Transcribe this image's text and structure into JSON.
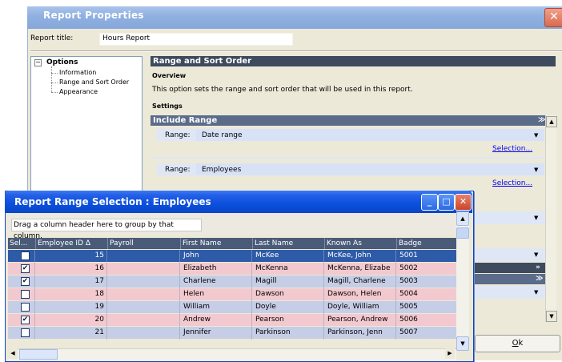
{
  "report_properties": {
    "title": "Report Properties",
    "close_glyph": "✕",
    "report_title_label": "Report title:",
    "report_title_value": "Hours Report",
    "tree": {
      "root": "Options",
      "expander": "−",
      "items": [
        "Information",
        "Range and Sort Order",
        "Appearance"
      ]
    },
    "section_title": "Range and Sort Order",
    "overview_label": "Overview",
    "overview_text": "This option sets the range and sort order  that will be used in this report.",
    "settings_label": "Settings",
    "include_range_label": "Include Range",
    "ranges": [
      {
        "label": "Range:",
        "value": "Date range",
        "link": "Selection..."
      },
      {
        "label": "Range:",
        "value": "Employees",
        "link": "Selection..."
      }
    ],
    "ok_label": "Ok",
    "ok_mnemonic": "O"
  },
  "range_selection": {
    "title": "Report Range Selection : Employees",
    "group_hint": "Drag a column header here to group by that column.",
    "columns": [
      "Sel...",
      "Employee ID",
      "Payroll",
      "First Name",
      "Last Name",
      "Known As",
      "Badge"
    ],
    "sort_glyph": "Δ",
    "rows": [
      {
        "sel": false,
        "id": "15",
        "payroll": "",
        "first": "John",
        "last": "McKee",
        "known": "McKee, John",
        "badge": "5001"
      },
      {
        "sel": true,
        "id": "16",
        "payroll": "",
        "first": "Elizabeth",
        "last": "McKenna",
        "known": "McKenna, Elizabe",
        "badge": "5002"
      },
      {
        "sel": true,
        "id": "17",
        "payroll": "",
        "first": "Charlene",
        "last": "Magill",
        "known": "Magill, Charlene",
        "badge": "5003"
      },
      {
        "sel": false,
        "id": "18",
        "payroll": "",
        "first": "Helen",
        "last": "Dawson",
        "known": "Dawson, Helen",
        "badge": "5004"
      },
      {
        "sel": false,
        "id": "19",
        "payroll": "",
        "first": "William",
        "last": "Doyle",
        "known": "Doyle, William",
        "badge": "5005"
      },
      {
        "sel": true,
        "id": "20",
        "payroll": "",
        "first": "Andrew",
        "last": "Pearson",
        "known": "Pearson, Andrew",
        "badge": "5006"
      },
      {
        "sel": false,
        "id": "21",
        "payroll": "",
        "first": "Jennifer",
        "last": "Parkinson",
        "known": "Parkinson, Jenn",
        "badge": "5007"
      }
    ]
  },
  "colors": {
    "selected_row": "#2e5ba8",
    "row_a": "#c6cde6",
    "row_b": "#f2c9cf",
    "header_bar": "#4a5b7a"
  }
}
